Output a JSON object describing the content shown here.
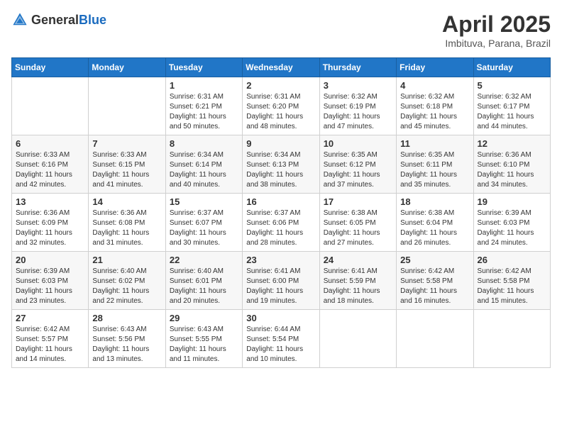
{
  "header": {
    "logo": {
      "text_general": "General",
      "text_blue": "Blue"
    },
    "title": "April 2025",
    "location": "Imbituva, Parana, Brazil"
  },
  "calendar": {
    "days_of_week": [
      "Sunday",
      "Monday",
      "Tuesday",
      "Wednesday",
      "Thursday",
      "Friday",
      "Saturday"
    ],
    "weeks": [
      [
        {
          "day": "",
          "info": ""
        },
        {
          "day": "",
          "info": ""
        },
        {
          "day": "1",
          "info": "Sunrise: 6:31 AM\nSunset: 6:21 PM\nDaylight: 11 hours and 50 minutes."
        },
        {
          "day": "2",
          "info": "Sunrise: 6:31 AM\nSunset: 6:20 PM\nDaylight: 11 hours and 48 minutes."
        },
        {
          "day": "3",
          "info": "Sunrise: 6:32 AM\nSunset: 6:19 PM\nDaylight: 11 hours and 47 minutes."
        },
        {
          "day": "4",
          "info": "Sunrise: 6:32 AM\nSunset: 6:18 PM\nDaylight: 11 hours and 45 minutes."
        },
        {
          "day": "5",
          "info": "Sunrise: 6:32 AM\nSunset: 6:17 PM\nDaylight: 11 hours and 44 minutes."
        }
      ],
      [
        {
          "day": "6",
          "info": "Sunrise: 6:33 AM\nSunset: 6:16 PM\nDaylight: 11 hours and 42 minutes."
        },
        {
          "day": "7",
          "info": "Sunrise: 6:33 AM\nSunset: 6:15 PM\nDaylight: 11 hours and 41 minutes."
        },
        {
          "day": "8",
          "info": "Sunrise: 6:34 AM\nSunset: 6:14 PM\nDaylight: 11 hours and 40 minutes."
        },
        {
          "day": "9",
          "info": "Sunrise: 6:34 AM\nSunset: 6:13 PM\nDaylight: 11 hours and 38 minutes."
        },
        {
          "day": "10",
          "info": "Sunrise: 6:35 AM\nSunset: 6:12 PM\nDaylight: 11 hours and 37 minutes."
        },
        {
          "day": "11",
          "info": "Sunrise: 6:35 AM\nSunset: 6:11 PM\nDaylight: 11 hours and 35 minutes."
        },
        {
          "day": "12",
          "info": "Sunrise: 6:36 AM\nSunset: 6:10 PM\nDaylight: 11 hours and 34 minutes."
        }
      ],
      [
        {
          "day": "13",
          "info": "Sunrise: 6:36 AM\nSunset: 6:09 PM\nDaylight: 11 hours and 32 minutes."
        },
        {
          "day": "14",
          "info": "Sunrise: 6:36 AM\nSunset: 6:08 PM\nDaylight: 11 hours and 31 minutes."
        },
        {
          "day": "15",
          "info": "Sunrise: 6:37 AM\nSunset: 6:07 PM\nDaylight: 11 hours and 30 minutes."
        },
        {
          "day": "16",
          "info": "Sunrise: 6:37 AM\nSunset: 6:06 PM\nDaylight: 11 hours and 28 minutes."
        },
        {
          "day": "17",
          "info": "Sunrise: 6:38 AM\nSunset: 6:05 PM\nDaylight: 11 hours and 27 minutes."
        },
        {
          "day": "18",
          "info": "Sunrise: 6:38 AM\nSunset: 6:04 PM\nDaylight: 11 hours and 26 minutes."
        },
        {
          "day": "19",
          "info": "Sunrise: 6:39 AM\nSunset: 6:03 PM\nDaylight: 11 hours and 24 minutes."
        }
      ],
      [
        {
          "day": "20",
          "info": "Sunrise: 6:39 AM\nSunset: 6:03 PM\nDaylight: 11 hours and 23 minutes."
        },
        {
          "day": "21",
          "info": "Sunrise: 6:40 AM\nSunset: 6:02 PM\nDaylight: 11 hours and 22 minutes."
        },
        {
          "day": "22",
          "info": "Sunrise: 6:40 AM\nSunset: 6:01 PM\nDaylight: 11 hours and 20 minutes."
        },
        {
          "day": "23",
          "info": "Sunrise: 6:41 AM\nSunset: 6:00 PM\nDaylight: 11 hours and 19 minutes."
        },
        {
          "day": "24",
          "info": "Sunrise: 6:41 AM\nSunset: 5:59 PM\nDaylight: 11 hours and 18 minutes."
        },
        {
          "day": "25",
          "info": "Sunrise: 6:42 AM\nSunset: 5:58 PM\nDaylight: 11 hours and 16 minutes."
        },
        {
          "day": "26",
          "info": "Sunrise: 6:42 AM\nSunset: 5:58 PM\nDaylight: 11 hours and 15 minutes."
        }
      ],
      [
        {
          "day": "27",
          "info": "Sunrise: 6:42 AM\nSunset: 5:57 PM\nDaylight: 11 hours and 14 minutes."
        },
        {
          "day": "28",
          "info": "Sunrise: 6:43 AM\nSunset: 5:56 PM\nDaylight: 11 hours and 13 minutes."
        },
        {
          "day": "29",
          "info": "Sunrise: 6:43 AM\nSunset: 5:55 PM\nDaylight: 11 hours and 11 minutes."
        },
        {
          "day": "30",
          "info": "Sunrise: 6:44 AM\nSunset: 5:54 PM\nDaylight: 11 hours and 10 minutes."
        },
        {
          "day": "",
          "info": ""
        },
        {
          "day": "",
          "info": ""
        },
        {
          "day": "",
          "info": ""
        }
      ]
    ]
  }
}
